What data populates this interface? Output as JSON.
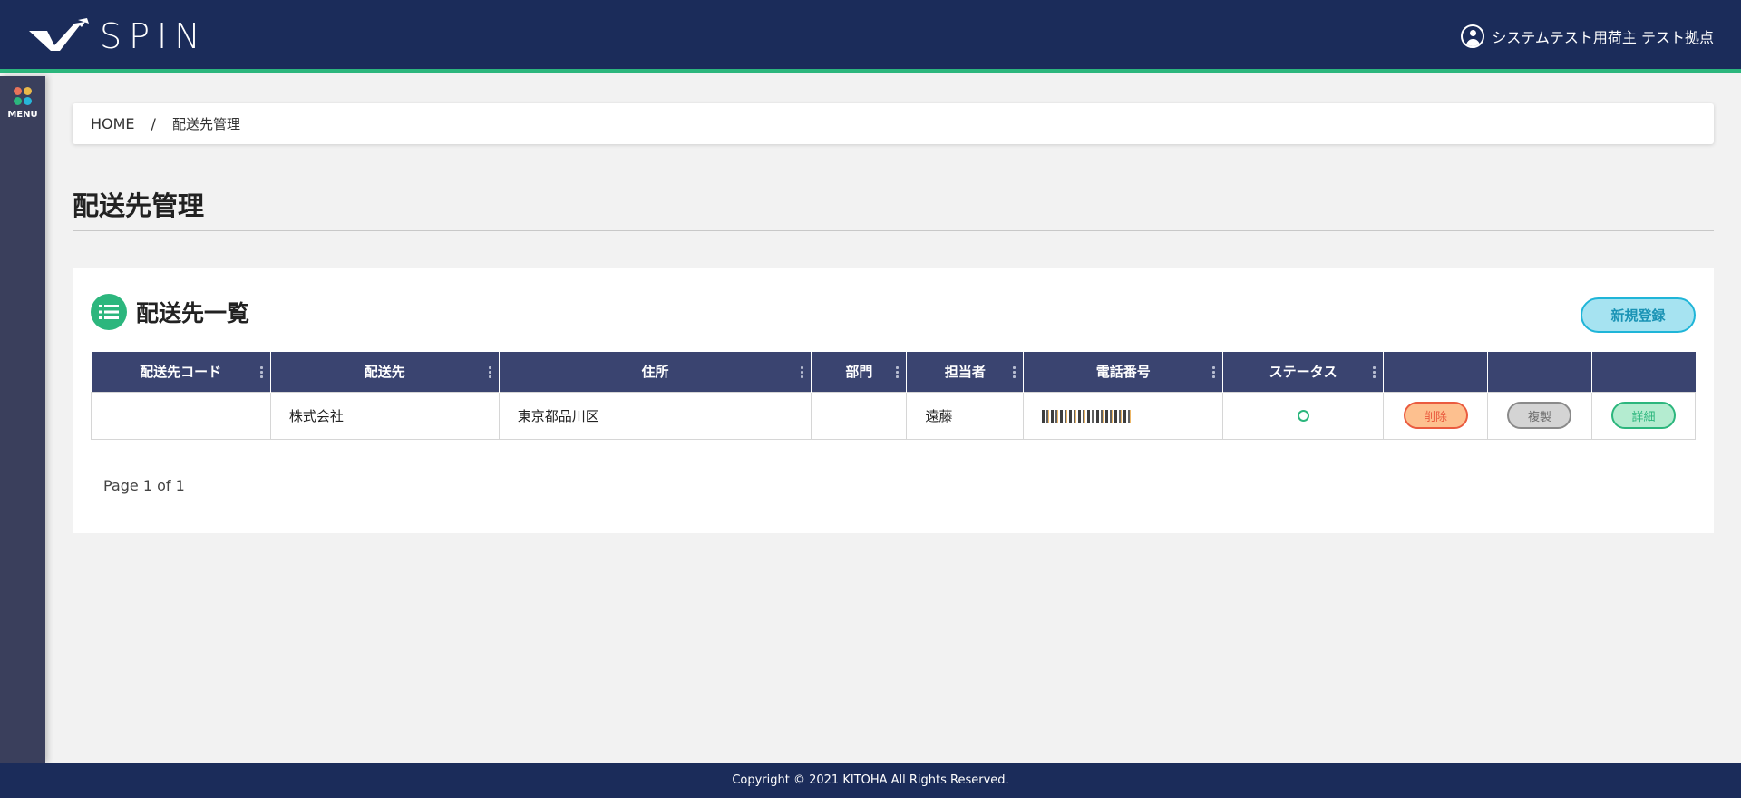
{
  "header": {
    "logo_text": "SPIN",
    "user_name": "システムテスト用荷主 テスト拠点"
  },
  "sidebar": {
    "menu_label": "MENU",
    "menu_dot_colors": [
      "#e8735a",
      "#e8b84a",
      "#2cb67d",
      "#27b6d8"
    ]
  },
  "breadcrumb": {
    "home": "HOME",
    "separator": "/",
    "current": "配送先管理"
  },
  "page": {
    "title": "配送先管理"
  },
  "card": {
    "title": "配送先一覧",
    "new_button": "新規登録",
    "icon": "list-icon"
  },
  "table": {
    "headers": [
      "配送先コード",
      "配送先",
      "住所",
      "部門",
      "担当者",
      "電話番号",
      "ステータス",
      "",
      "",
      ""
    ],
    "rows": [
      {
        "code": "",
        "name": "株式会社",
        "address": "東京都品川区",
        "department": "",
        "person": "遠藤",
        "phone": "",
        "status": "○",
        "delete_label": "削除",
        "copy_label": "複製",
        "detail_label": "詳細"
      }
    ]
  },
  "pagination": {
    "text": "Page 1 of 1"
  },
  "footer": {
    "copyright": "Copyright © 2021 KITOHA All Rights Reserved."
  },
  "colors": {
    "header_bg": "#1b2c5a",
    "accent_green": "#2cb67d",
    "table_header_bg": "#3a4470",
    "sidebar_bg": "#3a3f5c"
  }
}
